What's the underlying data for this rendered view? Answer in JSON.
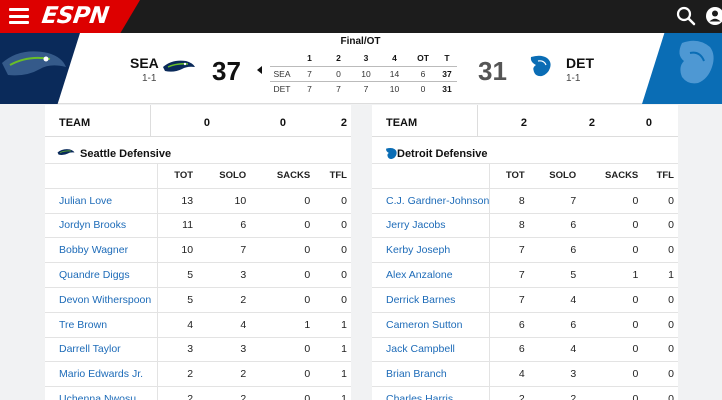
{
  "nav": {
    "logo": "ESPN"
  },
  "game": {
    "status": "Final/OT",
    "away": {
      "abbr": "SEA",
      "record": "1-1",
      "score": "37"
    },
    "home": {
      "abbr": "DET",
      "record": "1-1",
      "score": "31"
    },
    "linescore": {
      "headers": [
        "",
        "1",
        "2",
        "3",
        "4",
        "OT",
        "T"
      ],
      "rows": [
        [
          "SEA",
          "7",
          "0",
          "10",
          "14",
          "6",
          "37"
        ],
        [
          "DET",
          "7",
          "7",
          "7",
          "10",
          "0",
          "31"
        ]
      ]
    }
  },
  "left": {
    "team_row": {
      "label": "TEAM",
      "values": [
        "0",
        "0",
        "2"
      ]
    },
    "title": "Seattle Defensive",
    "columns": [
      "",
      "TOT",
      "SOLO",
      "SACKS",
      "TFL"
    ],
    "players": [
      [
        "Julian Love",
        "13",
        "10",
        "0",
        "0"
      ],
      [
        "Jordyn Brooks",
        "11",
        "6",
        "0",
        "0"
      ],
      [
        "Bobby Wagner",
        "10",
        "7",
        "0",
        "0"
      ],
      [
        "Quandre Diggs",
        "5",
        "3",
        "0",
        "0"
      ],
      [
        "Devon Witherspoon",
        "5",
        "2",
        "0",
        "0"
      ],
      [
        "Tre Brown",
        "4",
        "4",
        "1",
        "1"
      ],
      [
        "Darrell Taylor",
        "3",
        "3",
        "0",
        "1"
      ],
      [
        "Mario Edwards Jr.",
        "2",
        "2",
        "0",
        "1"
      ],
      [
        "Uchenna Nwosu",
        "2",
        "2",
        "0",
        "1"
      ]
    ]
  },
  "right": {
    "team_row": {
      "label": "TEAM",
      "values": [
        "2",
        "2",
        "0"
      ]
    },
    "title": "Detroit Defensive",
    "columns": [
      "",
      "TOT",
      "SOLO",
      "SACKS",
      "TFL"
    ],
    "players": [
      [
        "C.J. Gardner-Johnson",
        "8",
        "7",
        "0",
        "0"
      ],
      [
        "Jerry Jacobs",
        "8",
        "6",
        "0",
        "0"
      ],
      [
        "Kerby Joseph",
        "7",
        "6",
        "0",
        "0"
      ],
      [
        "Alex Anzalone",
        "7",
        "5",
        "1",
        "1"
      ],
      [
        "Derrick Barnes",
        "7",
        "4",
        "0",
        "0"
      ],
      [
        "Cameron Sutton",
        "6",
        "6",
        "0",
        "0"
      ],
      [
        "Jack Campbell",
        "6",
        "4",
        "0",
        "0"
      ],
      [
        "Brian Branch",
        "4",
        "3",
        "0",
        "0"
      ],
      [
        "Charles Harris",
        "2",
        "2",
        "0",
        "0"
      ]
    ]
  },
  "colors": {
    "espn_red": "#dd0000",
    "link_blue": "#1d6bb8",
    "sea_navy": "#0a2a5a",
    "det_blue": "#0a6db5"
  }
}
